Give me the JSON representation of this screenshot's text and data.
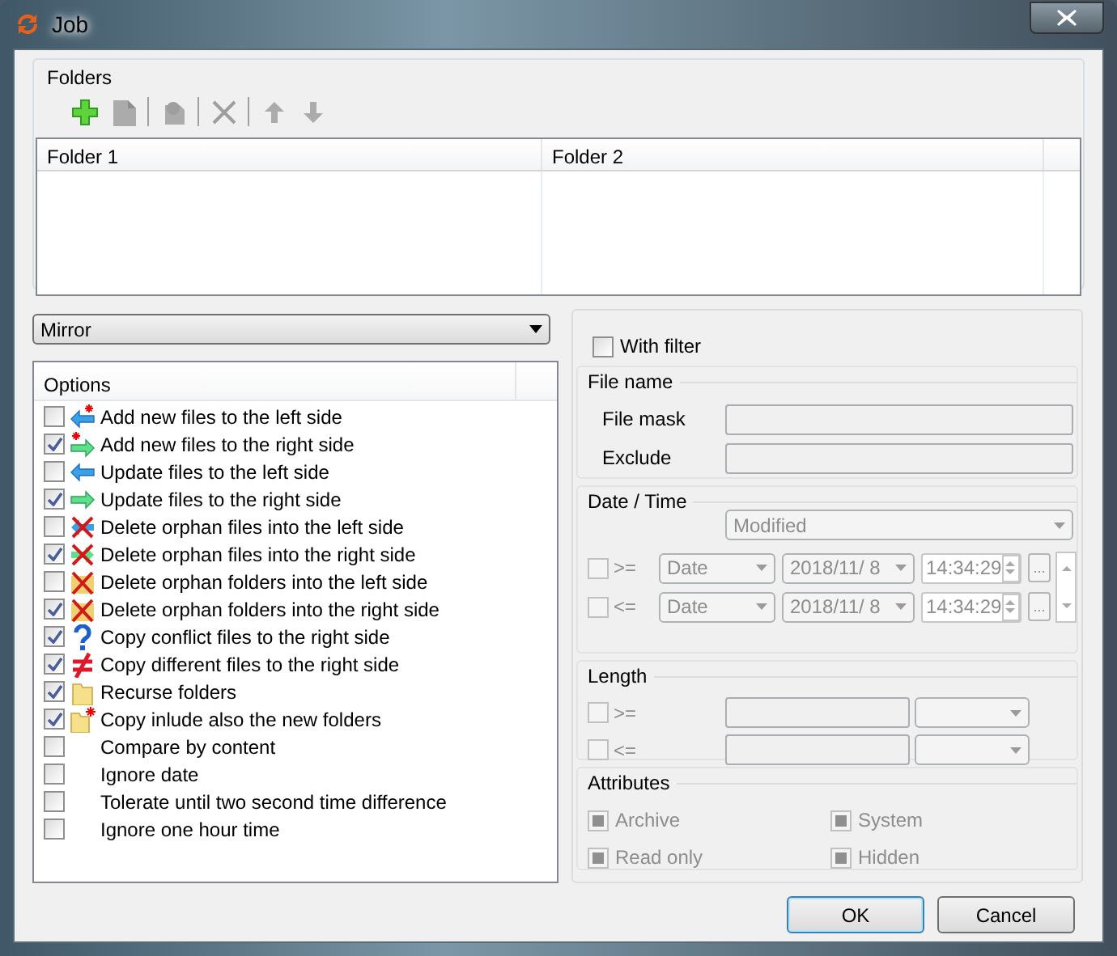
{
  "window": {
    "title": "Job"
  },
  "folders": {
    "title": "Folders",
    "toolbar": [
      [
        {
          "kind": "add",
          "disabled": false
        },
        {
          "kind": "edit",
          "disabled": true
        }
      ],
      [
        {
          "kind": "copy",
          "disabled": true
        }
      ],
      [
        {
          "kind": "delete",
          "disabled": true
        }
      ],
      [
        {
          "kind": "up",
          "disabled": true
        },
        {
          "kind": "down",
          "disabled": true
        }
      ]
    ],
    "columns": [
      "Folder 1",
      "Folder 2"
    ]
  },
  "mode": {
    "value": "Mirror"
  },
  "options": {
    "title": "Options",
    "items": [
      {
        "label": "Add new files to the left side",
        "checked": false,
        "kind": "add-left"
      },
      {
        "label": "Add new files to the right side",
        "checked": true,
        "kind": "add-right"
      },
      {
        "label": "Update files to the left side",
        "checked": false,
        "kind": "update-left"
      },
      {
        "label": "Update files to the right side",
        "checked": true,
        "kind": "update-right"
      },
      {
        "label": "Delete orphan files into the left side",
        "checked": false,
        "kind": "delete-left"
      },
      {
        "label": "Delete orphan files into the right side",
        "checked": true,
        "kind": "delete-right"
      },
      {
        "label": "Delete orphan folders into the left side",
        "checked": false,
        "kind": "delete-folder"
      },
      {
        "label": "Delete orphan folders into the right side",
        "checked": true,
        "kind": "delete-folder"
      },
      {
        "label": "Copy conflict files to the right side",
        "checked": true,
        "kind": "conflict"
      },
      {
        "label": "Copy different files to the right side",
        "checked": true,
        "kind": "different"
      },
      {
        "label": "Recurse folders",
        "checked": true,
        "kind": "folder"
      },
      {
        "label": "Copy inlude also the new folders",
        "checked": true,
        "kind": "new-folder"
      },
      {
        "label": "Compare by content",
        "checked": false,
        "kind": "plain"
      },
      {
        "label": "Ignore date",
        "checked": false,
        "kind": "plain"
      },
      {
        "label": "Tolerate until two second time difference",
        "checked": false,
        "kind": "plain"
      },
      {
        "label": "Ignore one hour time",
        "checked": false,
        "kind": "plain"
      }
    ]
  },
  "filter": {
    "with_filter": {
      "label": "With filter",
      "checked": false
    },
    "file_name": {
      "title": "File name",
      "fields": [
        {
          "label": "File mask"
        },
        {
          "label": "Exclude"
        }
      ]
    },
    "date_time": {
      "title": "Date / Time",
      "field": "Modified",
      "rows": [
        {
          "checked": false,
          "operator": ">=",
          "type": "Date",
          "date": "2018/11/ 8",
          "time": "14:34:29",
          "more": "..."
        },
        {
          "checked": false,
          "operator": "<=",
          "type": "Date",
          "date": "2018/11/ 8",
          "time": "14:34:29",
          "more": "..."
        }
      ]
    },
    "length": {
      "title": "Length",
      "rows": [
        {
          "checked": false,
          "operator": ">="
        },
        {
          "checked": false,
          "operator": "<="
        }
      ]
    },
    "attributes": {
      "title": "Attributes",
      "items": [
        {
          "label": "Archive",
          "indeterminate": true
        },
        {
          "label": "System",
          "indeterminate": true
        },
        {
          "label": "Read only",
          "indeterminate": true
        },
        {
          "label": "Hidden",
          "indeterminate": true
        }
      ]
    }
  },
  "buttons": [
    {
      "label": "OK",
      "default": true
    },
    {
      "label": "Cancel",
      "default": false
    }
  ]
}
